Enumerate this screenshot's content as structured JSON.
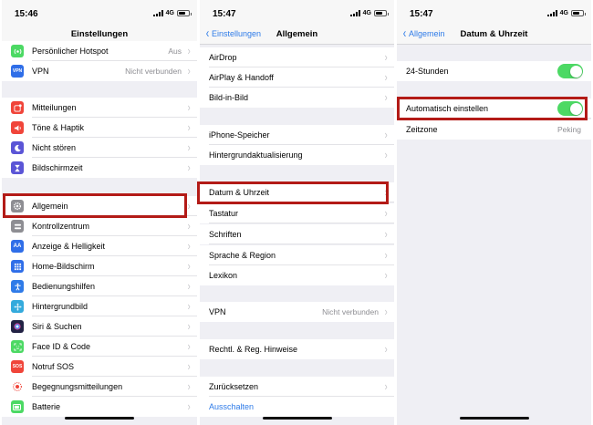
{
  "status_bar": {
    "panel1": {
      "time": "15:46",
      "network": "4G"
    },
    "panel2": {
      "time": "15:47",
      "network": "4G"
    },
    "panel3": {
      "time": "15:47",
      "network": "4G"
    }
  },
  "panel1": {
    "title": "Einstellungen",
    "rows": [
      {
        "label": "Persönlicher Hotspot",
        "value": "Aus",
        "icon": "hotspot-icon",
        "color": "#4cd964"
      },
      {
        "label": "VPN",
        "value": "Nicht verbunden",
        "icon": "vpn-icon",
        "glyph": "VPN",
        "color": "#2f6ee8"
      },
      {
        "label": "Mitteilungen",
        "icon": "notifications-icon",
        "color": "#f0453a"
      },
      {
        "label": "Töne & Haptik",
        "icon": "sounds-icon",
        "color": "#f0453a"
      },
      {
        "label": "Nicht stören",
        "icon": "moon-icon",
        "color": "#5b55d6"
      },
      {
        "label": "Bildschirmzeit",
        "icon": "hourglass-icon",
        "color": "#5b55d6"
      },
      {
        "label": "Allgemein",
        "icon": "gear-icon",
        "color": "#8e8e93"
      },
      {
        "label": "Kontrollzentrum",
        "icon": "control-center-icon",
        "color": "#8e8e93"
      },
      {
        "label": "Anzeige & Helligkeit",
        "icon": "display-icon",
        "glyph": "AA",
        "color": "#2f6ee8"
      },
      {
        "label": "Home-Bildschirm",
        "icon": "home-screen-icon",
        "color": "#2f6ee8"
      },
      {
        "label": "Bedienungshilfen",
        "icon": "accessibility-icon",
        "color": "#2f7be8"
      },
      {
        "label": "Hintergrundbild",
        "icon": "wallpaper-icon",
        "color": "#34aadc"
      },
      {
        "label": "Siri & Suchen",
        "icon": "siri-icon",
        "color": "#222244"
      },
      {
        "label": "Face ID & Code",
        "icon": "face-id-icon",
        "color": "#4cd964"
      },
      {
        "label": "Notruf SOS",
        "icon": "sos-icon",
        "glyph": "SOS",
        "color": "#f0453a"
      },
      {
        "label": "Begegnungsmitteilungen",
        "icon": "exposure-icon",
        "color": "#f0453a"
      },
      {
        "label": "Batterie",
        "icon": "battery-icon",
        "color": "#4cd964"
      }
    ]
  },
  "panel2": {
    "back": "Einstellungen",
    "title": "Allgemein",
    "rows": [
      {
        "label": "AirDrop"
      },
      {
        "label": "AirPlay & Handoff"
      },
      {
        "label": "Bild-in-Bild"
      },
      {
        "label": "iPhone-Speicher"
      },
      {
        "label": "Hintergrundaktualisierung"
      },
      {
        "label": "Datum & Uhrzeit"
      },
      {
        "label": "Tastatur"
      },
      {
        "label": "Schriften"
      },
      {
        "label": "Sprache & Region"
      },
      {
        "label": "Lexikon"
      },
      {
        "label": "VPN",
        "value": "Nicht verbunden"
      },
      {
        "label": "Rechtl. & Reg. Hinweise"
      },
      {
        "label": "Zurücksetzen"
      },
      {
        "label": "Ausschalten"
      }
    ]
  },
  "panel3": {
    "back": "Allgemein",
    "title": "Datum & Uhrzeit",
    "rows": [
      {
        "label": "24-Stunden",
        "toggle": true
      },
      {
        "label": "Automatisch einstellen",
        "toggle": true
      },
      {
        "label": "Zeitzone",
        "value": "Peking"
      }
    ]
  },
  "colors": {
    "accent": "#2e7be8",
    "highlight": "#b31b17",
    "toggle_on": "#4cd964"
  }
}
